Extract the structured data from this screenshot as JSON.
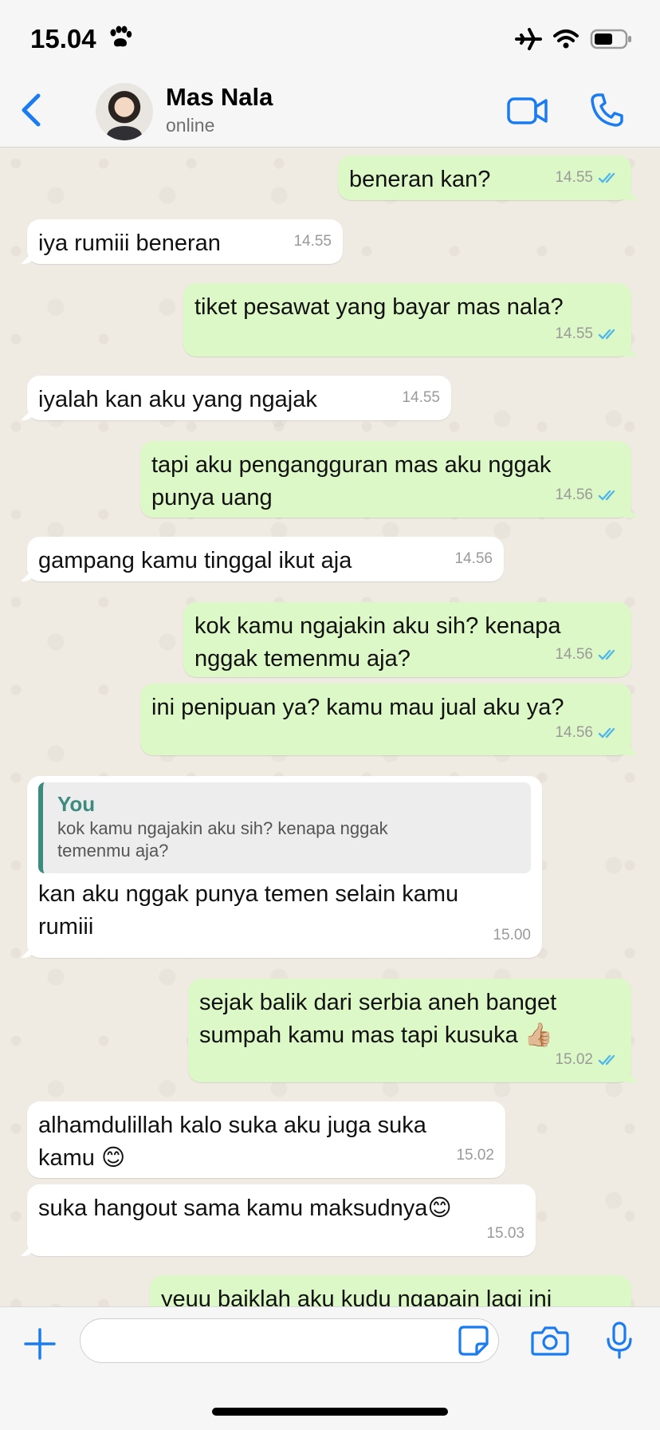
{
  "status_bar": {
    "time": "15.04",
    "icons": [
      "paw-icon",
      "airplane-icon",
      "wifi-icon",
      "battery-icon"
    ]
  },
  "header": {
    "name": "Mas Nala",
    "status": "online",
    "icons": [
      "back-chevron-icon",
      "video-call-icon",
      "phone-icon"
    ]
  },
  "colors": {
    "accent": "#1a7cf0",
    "outgoing_bubble": "#dcf8c6",
    "incoming_bubble": "#ffffff",
    "quote_accent": "#3b8b80",
    "read_tick": "#4fb6ec"
  },
  "messages": [
    {
      "dir": "out",
      "text": "beneran kan?",
      "time": "14.55"
    },
    {
      "dir": "in",
      "text": "iya rumiii beneran",
      "time": "14.55"
    },
    {
      "dir": "out",
      "text": "tiket pesawat yang bayar mas nala?",
      "time": "14.55"
    },
    {
      "dir": "in",
      "text": "iyalah kan aku yang ngajak",
      "time": "14.55"
    },
    {
      "dir": "out",
      "text": "tapi aku pengangguran mas aku nggak\npunya uang",
      "time": "14.56"
    },
    {
      "dir": "in",
      "text": "gampang kamu tinggal ikut aja",
      "time": "14.56"
    },
    {
      "dir": "out",
      "text": "kok kamu ngajakin aku sih? kenapa\nnggak temenmu aja?",
      "time": "14.56"
    },
    {
      "dir": "out",
      "text": "ini penipuan ya? kamu mau jual aku ya?",
      "time": "14.56"
    },
    {
      "dir": "in",
      "quote_author": "You",
      "quote_text": "kok kamu ngajakin aku sih? kenapa nggak\ntemenmu aja?",
      "text": "kan aku nggak punya temen selain kamu\nrumiii",
      "time": "15.00"
    },
    {
      "dir": "out",
      "text": "sejak balik dari serbia aneh banget\nsumpah kamu mas tapi kusuka 👍🏼",
      "time": "15.02"
    },
    {
      "dir": "in",
      "text": "alhamdulillah kalo suka aku juga suka\nkamu 😊",
      "time": "15.02"
    },
    {
      "dir": "in",
      "text": "suka hangout sama kamu maksudnya😊",
      "time": "15.03"
    },
    {
      "dir": "out",
      "text": "yeuu baiklah aku kudu ngapain lagi ini",
      "time": ""
    }
  ],
  "input": {
    "placeholder": "",
    "value": ""
  },
  "input_icons": [
    "plus-icon",
    "sticker-icon",
    "camera-icon",
    "microphone-icon"
  ]
}
